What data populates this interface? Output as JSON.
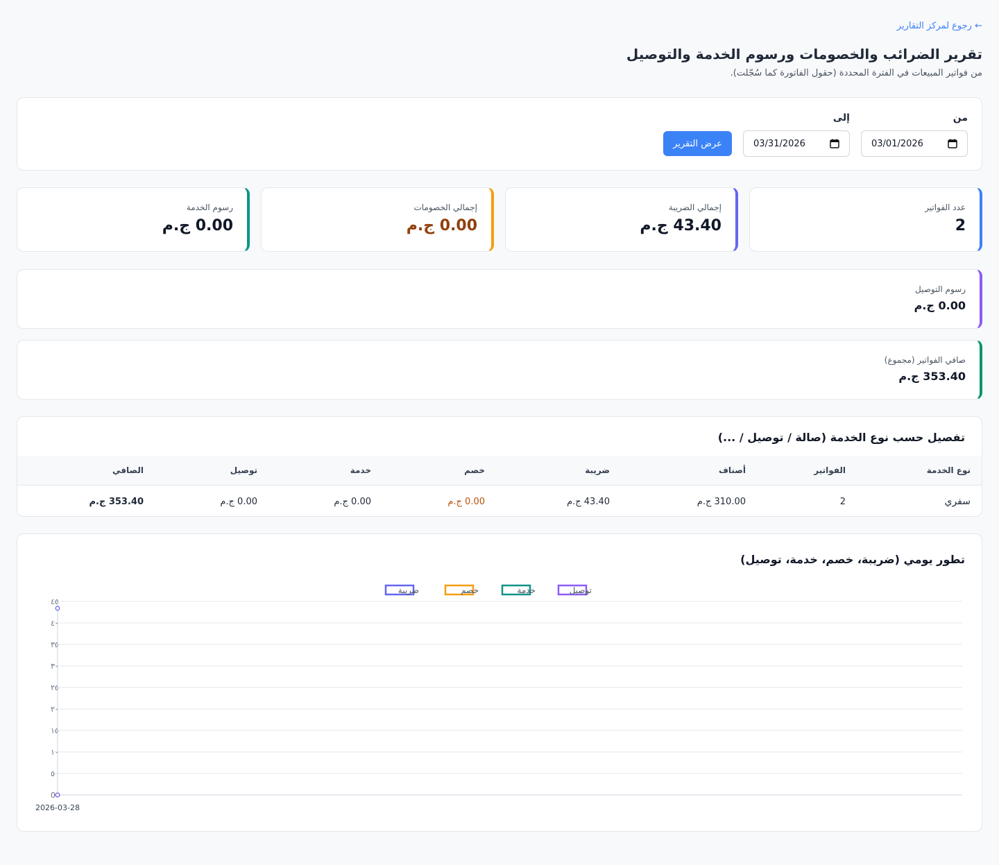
{
  "header": {
    "back_link": "← رجوع لمركز التقارير",
    "title": "تقرير الضرائب والخصومات ورسوم الخدمة والتوصيل",
    "subtitle": "من فواتير المبيعات في الفترة المحددة (حقول الفاتورة كما سُجّلت)."
  },
  "filter": {
    "from_label": "من",
    "to_label": "إلى",
    "from_value": "03/01/2026",
    "to_value": "03/31/2026",
    "submit_label": "عرض التقرير"
  },
  "stats": [
    {
      "label": "عدد الفواتير",
      "value": "2",
      "accent": "#3b82f6",
      "value_color": "#111827"
    },
    {
      "label": "إجمالي الضريبة",
      "value": "43.40 ج.م",
      "accent": "#6366f1",
      "value_color": "#111827"
    },
    {
      "label": "إجمالي الخصومات",
      "value": "0.00 ج.م",
      "accent": "#f59e0b",
      "value_color": "#92400e"
    },
    {
      "label": "رسوم الخدمة",
      "value": "0.00 ج.م",
      "accent": "#0d9488",
      "value_color": "#111827"
    }
  ],
  "delivery": {
    "label": "رسوم التوصيل",
    "value": "0.00 ج.م",
    "accent": "#8b5cf6"
  },
  "net": {
    "label": "صافي الفواتير (مجموع)",
    "value": "353.40 ج.م",
    "accent": "#059669"
  },
  "breakdown": {
    "title": "تفصيل حسب نوع الخدمة (صالة / توصيل / ...)",
    "columns": [
      "نوع الخدمة",
      "الفواتير",
      "أصناف",
      "ضريبة",
      "خصم",
      "خدمة",
      "توصيل",
      "الصافي"
    ],
    "rows": [
      [
        "سفري",
        "2",
        "310.00 ج.م",
        "43.40 ج.م",
        "0.00 ج.م",
        "0.00 ج.م",
        "0.00 ج.م",
        "353.40 ج.م"
      ]
    ]
  },
  "chart_data": {
    "type": "line",
    "title": "تطور يومي (ضريبة، خصم، خدمة، توصيل)",
    "x": [
      "2026-03-28"
    ],
    "series": [
      {
        "name": "ضريبة",
        "values": [
          43.4
        ],
        "color": "#6366f1"
      },
      {
        "name": "خصم",
        "values": [
          0
        ],
        "color": "#f59e0b"
      },
      {
        "name": "خدمة",
        "values": [
          0
        ],
        "color": "#0d9488"
      },
      {
        "name": "توصيل",
        "values": [
          0
        ],
        "color": "#8b5cf6"
      }
    ],
    "yticks": [
      "0",
      "٥",
      "١٠",
      "١٥",
      "٢٠",
      "٢٥",
      "٣٠",
      "٣٥",
      "٤٠",
      "٤٥"
    ],
    "ylim": [
      0,
      45
    ],
    "legend": "top-center",
    "grid": true
  }
}
